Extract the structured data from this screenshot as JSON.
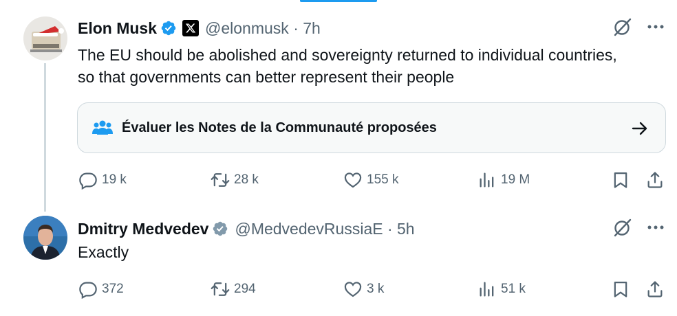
{
  "tweets": [
    {
      "name": "Elon Musk",
      "handle": "@elonmusk · 7h",
      "text": "The EU should be abolished and sovereignty returned to individual countries, so that governments can better represent their people",
      "community_notes_label": "Évaluer les Notes de la Communauté proposées",
      "replies": "19 k",
      "retweets": "28 k",
      "likes": "155 k",
      "views": "19 M",
      "verified_color": "#1d9bf0"
    },
    {
      "name": "Dmitry Medvedev",
      "handle": "@MedvedevRussiaE · 5h",
      "text": "Exactly",
      "replies": "372",
      "retweets": "294",
      "likes": "3 k",
      "views": "51 k",
      "verified_color": "#829aab"
    }
  ],
  "colors": {
    "accent": "#1d9bf0",
    "muted": "#536471",
    "text": "#0f1419",
    "gov_badge": "#829aab"
  },
  "icons": [
    "verified-badge-icon",
    "x-logo-icon",
    "grok-icon",
    "more-icon",
    "community-notes-icon",
    "arrow-right-icon",
    "reply-icon",
    "retweet-icon",
    "like-icon",
    "views-icon",
    "bookmark-icon",
    "share-icon"
  ]
}
